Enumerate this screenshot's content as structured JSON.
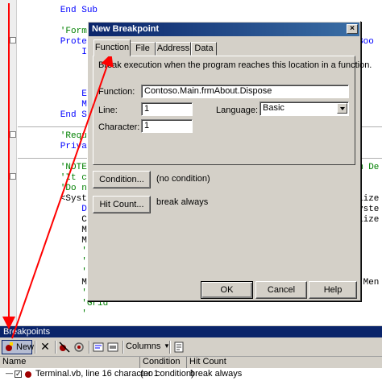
{
  "code": {
    "lines": [
      {
        "kw": "        End Sub",
        "tx": "",
        "cm": ""
      },
      {
        "kw": "",
        "tx": "",
        "cm": ""
      },
      {
        "kw": "",
        "tx": "",
        "cm": "        'Form ove"
      },
      {
        "kw": "        Protecte",
        "tx": "",
        "cm": ""
      },
      {
        "kw": "            If d",
        "tx": "",
        "cm": ""
      },
      {
        "kw": "",
        "tx": "",
        "cm": ""
      },
      {
        "kw": "",
        "tx": "",
        "cm": ""
      },
      {
        "kw": "",
        "tx": "",
        "cm": ""
      },
      {
        "kw": "            End",
        "tx": "",
        "cm": ""
      },
      {
        "kw": "            MyBa",
        "tx": "",
        "cm": ""
      },
      {
        "kw": "        End Sub",
        "tx": "",
        "cm": ""
      },
      {
        "kw": "",
        "tx": "",
        "cm": ""
      },
      {
        "kw": "",
        "tx": "",
        "cm": "        'Require"
      },
      {
        "kw": "        Private",
        "tx": "",
        "cm": ""
      },
      {
        "kw": "",
        "tx": "",
        "cm": ""
      },
      {
        "kw": "",
        "tx": "",
        "cm": "        'NOTE: T"
      },
      {
        "kw": "",
        "tx": "",
        "cm": "        'It can "
      },
      {
        "kw": "",
        "tx": "",
        "cm": "        'Do not "
      },
      {
        "kw": "",
        "tx": "        <System.",
        "cm": ""
      },
      {
        "kw": "            Dim",
        "tx": "",
        "cm": ""
      },
      {
        "kw": "",
        "tx": "            CType",
        "cm": ""
      },
      {
        "kw": "",
        "tx": "            Me.p",
        "cm": ""
      },
      {
        "kw": "",
        "tx": "            Me.S",
        "cm": ""
      },
      {
        "kw": "",
        "tx": "",
        "cm": "            '"
      },
      {
        "kw": "",
        "tx": "",
        "cm": "            'Men"
      },
      {
        "kw": "",
        "tx": "",
        "cm": "            '"
      },
      {
        "kw": "",
        "tx": "            Me.Me",
        "cm": ""
      },
      {
        "kw": "",
        "tx": "",
        "cm": "            '"
      },
      {
        "kw": "",
        "tx": "",
        "cm": "            'Grid"
      },
      {
        "kw": "",
        "tx": "",
        "cm": "            '"
      }
    ],
    "right_fragments": [
      {
        "row": 3,
        "text": "Boo",
        "cls": "kw"
      },
      {
        "row": 15,
        "text": "m De",
        "cls": "cm"
      },
      {
        "row": 18,
        "text": "lize",
        "cls": "tx"
      },
      {
        "row": 19,
        "text": "yste",
        "cls": "tx"
      },
      {
        "row": 20,
        "text": "lize",
        "cls": "tx"
      },
      {
        "row": 26,
        "text": "\"Men",
        "cls": "tx"
      }
    ]
  },
  "dialog": {
    "title": "New Breakpoint",
    "close_glyph": "×",
    "tabs": [
      {
        "label": "Function",
        "active": true
      },
      {
        "label": "File",
        "active": false
      },
      {
        "label": "Address",
        "active": false
      },
      {
        "label": "Data",
        "active": false
      }
    ],
    "description": "Break execution when the program reaches this location in a function.",
    "function_label": "Function:",
    "function_value": "Contoso.Main.frmAbout.Dispose",
    "line_label": "Line:",
    "line_value": "1",
    "character_label": "Character:",
    "character_value": "1",
    "language_label": "Language:",
    "language_value": "Basic",
    "condition_button": "Condition...",
    "condition_status": "(no condition)",
    "hitcount_button": "Hit Count...",
    "hitcount_status": "break always",
    "ok_button": "OK",
    "cancel_button": "Cancel",
    "help_button": "Help"
  },
  "breakpoints": {
    "title": "Breakpoints",
    "new_button": "New",
    "columns_button": "Columns",
    "headers": [
      "Name",
      "Condition",
      "Hit Count"
    ],
    "row": {
      "name": "Terminal.vb, line 16 character 1",
      "condition": "(no condition)",
      "hit_count": "break always",
      "checked": true
    }
  },
  "colors": {
    "title_bar": "#0a246a",
    "annotation_arrow": "#ff0000",
    "breakpoint_dot": "#a00000"
  }
}
